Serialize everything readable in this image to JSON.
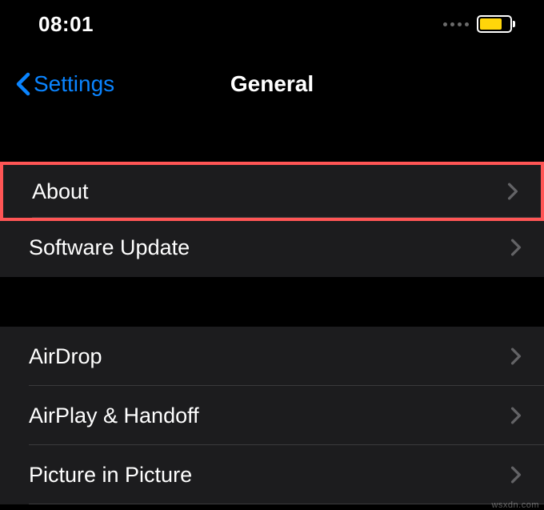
{
  "status": {
    "time": "08:01",
    "battery_color": "#ffd60a"
  },
  "nav": {
    "back_label": "Settings",
    "title": "General"
  },
  "groups": [
    {
      "items": [
        {
          "label": "About",
          "highlighted": true
        },
        {
          "label": "Software Update",
          "highlighted": false
        }
      ]
    },
    {
      "items": [
        {
          "label": "AirDrop",
          "highlighted": false
        },
        {
          "label": "AirPlay & Handoff",
          "highlighted": false
        },
        {
          "label": "Picture in Picture",
          "highlighted": false
        }
      ]
    }
  ],
  "watermark": "wsxdn.com"
}
